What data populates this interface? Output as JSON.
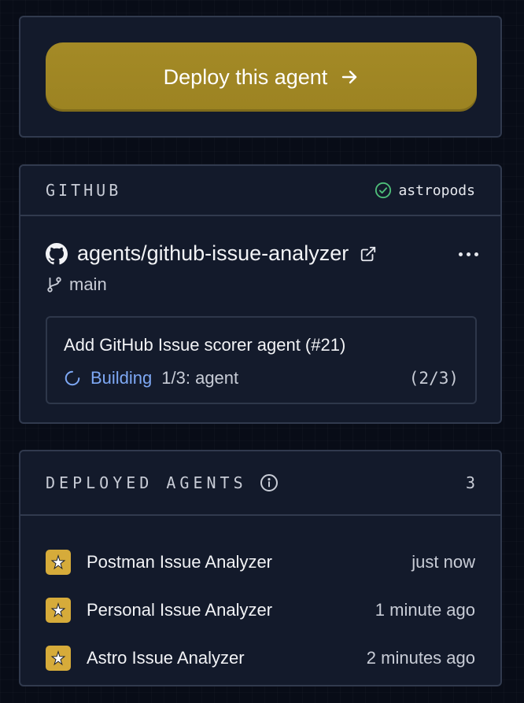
{
  "deploy": {
    "label": "Deploy this agent"
  },
  "github": {
    "section_label": "GITHUB",
    "account": "astropods",
    "repo": "agents/github-issue-analyzer",
    "branch": "main",
    "build": {
      "commit_title": "Add GitHub Issue scorer agent (#21)",
      "status": "Building",
      "step": "1/3: agent",
      "progress": "(2/3)"
    }
  },
  "deployed": {
    "section_label": "DEPLOYED AGENTS",
    "count": "3",
    "agents": [
      {
        "name": "Postman Issue Analyzer",
        "time": "just now"
      },
      {
        "name": "Personal Issue Analyzer",
        "time": "1 minute ago"
      },
      {
        "name": "Astro Issue Analyzer",
        "time": "2 minutes ago"
      }
    ]
  },
  "colors": {
    "accent": "#a48a26",
    "building": "#7ea8f4",
    "success": "#4fbf7a",
    "agent_icon": "#d6ab3a"
  },
  "icons": [
    "arrow-right-icon",
    "check-circle-icon",
    "github-icon",
    "external-link-icon",
    "more-icon",
    "git-branch-icon",
    "spinner-icon",
    "info-icon",
    "agent-logo-icon"
  ]
}
